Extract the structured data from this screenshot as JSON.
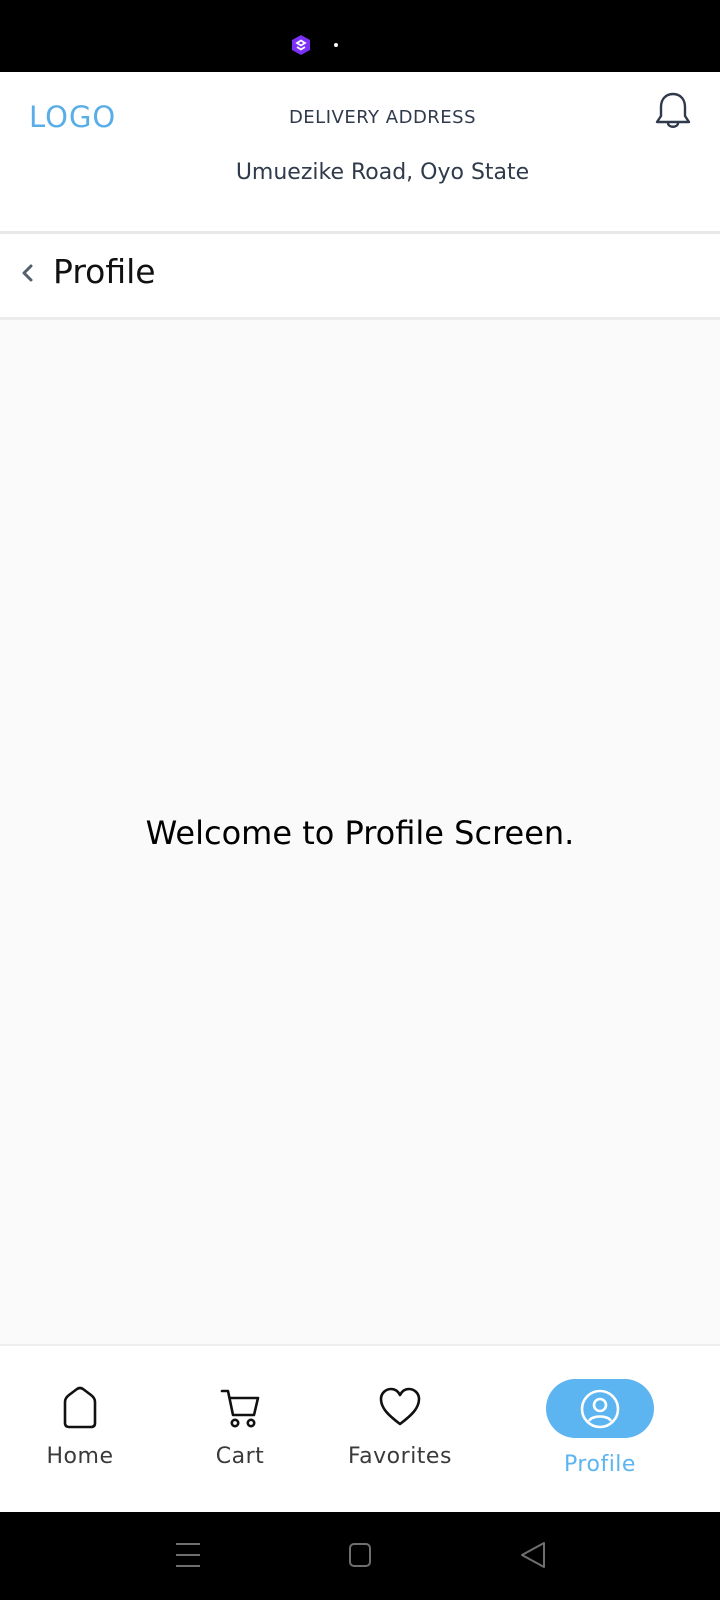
{
  "header": {
    "logo": "LOGO",
    "delivery_label": "DELIVERY ADDRESS",
    "delivery_address": "Umuezike Road, Oyo State"
  },
  "page": {
    "title": "Profile",
    "welcome_text": "Welcome to Profile Screen."
  },
  "bottom_nav": {
    "items": [
      {
        "label": "Home",
        "icon": "home-icon"
      },
      {
        "label": "Cart",
        "icon": "cart-icon"
      },
      {
        "label": "Favorites",
        "icon": "heart-icon"
      },
      {
        "label": "Profile",
        "icon": "user-circle-icon",
        "active": true
      }
    ]
  },
  "colors": {
    "accent": "#5cb4f0",
    "logo": "#5aaee8",
    "text_dark": "#2f3a4b"
  }
}
